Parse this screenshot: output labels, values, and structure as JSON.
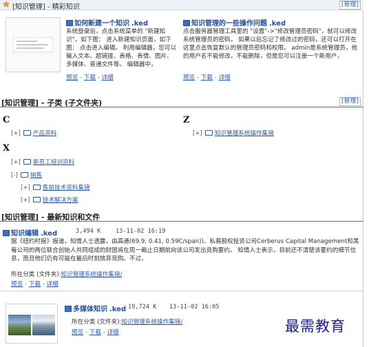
{
  "featured": {
    "title": "[知识管理] - 精彩知识",
    "manage_label": "[管理]",
    "items": [
      {
        "title": "如何新建一个知识",
        "ext": ".ked",
        "desc": "系统登录后，点击系统菜单的 \"新建知识\"，如下图： 进入新建知识页面，如下图： 点击进入编辑。 利用编辑器，您可以输入文本、超链接、表格、表情、图片、多媒体、普通文件等。 编辑器中，",
        "preview": "预览",
        "download": "下载",
        "detail": "详细"
      },
      {
        "title": "知识管理的一些操作问题",
        "ext": ".ked",
        "desc": "点击服务器管理工具里的 \"设置\"->\"修改管理员密码\"，就可以修改系统管理员的密码。 如果以后忘记了修改过的密码，还可以打开在这里点击恢复默认的管理员密码和权限。 admin是系统管理员，他的用户名不能修改，不能删除，但是您可以注册一个新用户，",
        "preview": "预览",
        "download": "下载",
        "detail": "详细"
      }
    ]
  },
  "subcategories": {
    "title": "[知识管理] - 子类 (子文件夹)",
    "manage_label": "[管理]",
    "groups": [
      {
        "letter": "C",
        "items": [
          {
            "toggle": "[+]",
            "label": "产品资料"
          }
        ]
      },
      {
        "letter": "Z",
        "items": [
          {
            "toggle": "[+]",
            "label": "知识管理系统操作集锦"
          }
        ]
      },
      {
        "letter": "X",
        "items": [
          {
            "toggle": "[+]",
            "label": "新员工培训资料"
          },
          {
            "toggle": "[-]",
            "label": "销售"
          },
          {
            "toggle": "[+]",
            "label": "售前技术资料集锦"
          },
          {
            "toggle": "[+]",
            "label": "技术解决方案"
          }
        ]
      }
    ]
  },
  "latest": {
    "title": "[知识管理] - 最新知识和文件",
    "items": [
      {
        "title": "知识编辑",
        "ext": ".ked",
        "size": "3,494 K",
        "date": "13-11-02 16:19",
        "excerpt": "据《纽约时报》报道，知情人士透露，由高通(69.9, 0.41, 0.59C/span))、私募股权投资公司Cerberus Capital Management和黑莓公司的两位联合创始人共同组成的财团将在周一截止日期前向该公司发出竞购要约。 知情人士表示，目前还不清楚该要约的细节信息，而且他们仍有可能在最后时刻放弃竞购。不过，",
        "category_prefix": "所在分类 (文件夹):",
        "category": "知识管理系统操作集锦/",
        "preview": "预览",
        "download": "下载",
        "detail": "详细"
      },
      {
        "title": "多媒体知识",
        "ext": ".ked",
        "size": "19,724 K",
        "date": "13-11-02 16:05",
        "category_prefix": "所在分类 (文件夹):",
        "category": "知识管理系统操作集锦/",
        "preview": "预览",
        "download": "下载",
        "detail": "详细"
      }
    ]
  },
  "watermark": "最需教育"
}
